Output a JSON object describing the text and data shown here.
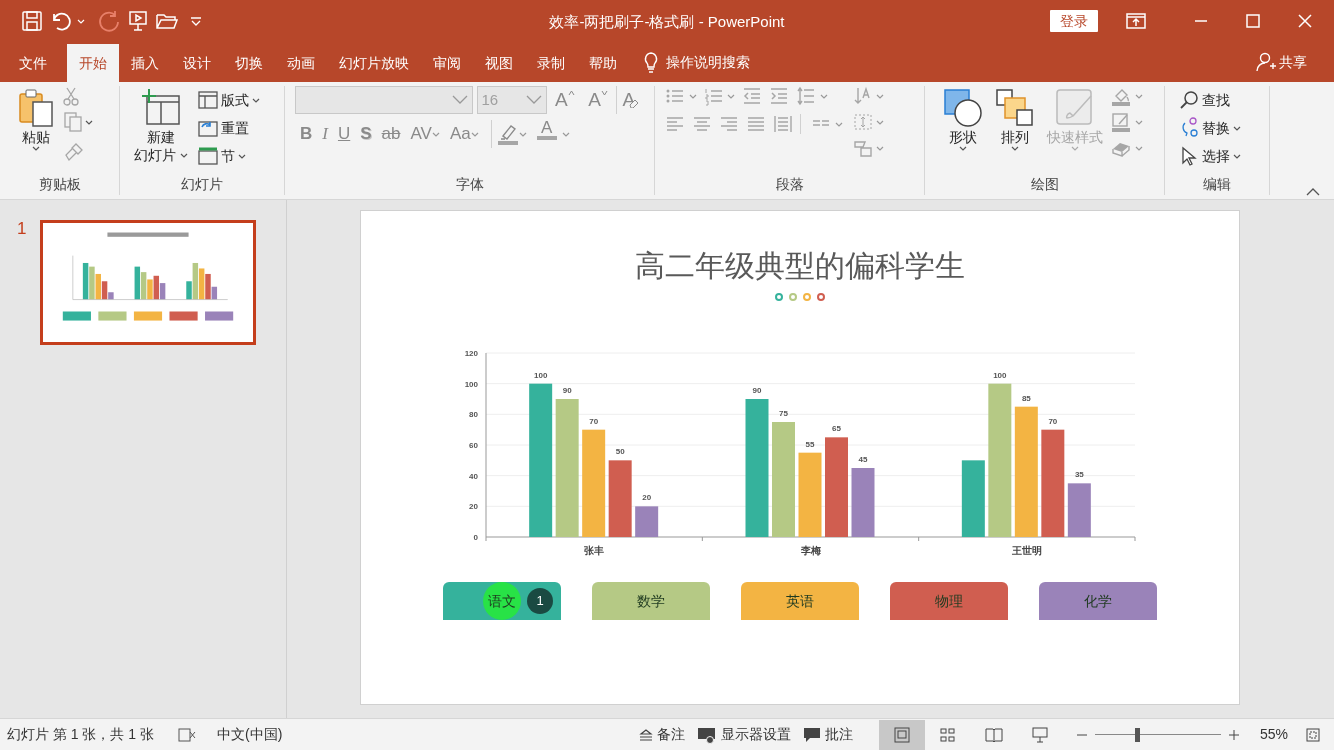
{
  "window": {
    "title": "效率-两把刷子-格式刷  -  PowerPoint",
    "signin": "登录"
  },
  "ribbon_tabs": [
    {
      "label": "文件",
      "selected": false
    },
    {
      "label": "开始",
      "selected": true
    },
    {
      "label": "插入",
      "selected": false
    },
    {
      "label": "设计",
      "selected": false
    },
    {
      "label": "切换",
      "selected": false
    },
    {
      "label": "动画",
      "selected": false
    },
    {
      "label": "幻灯片放映",
      "selected": false
    },
    {
      "label": "审阅",
      "selected": false
    },
    {
      "label": "视图",
      "selected": false
    },
    {
      "label": "录制",
      "selected": false
    },
    {
      "label": "帮助",
      "selected": false
    }
  ],
  "tell_me": "操作说明搜索",
  "share": "共享",
  "ribbon": {
    "clipboard": {
      "paste": "粘贴",
      "label": "剪贴板"
    },
    "slides": {
      "new_slide": [
        "新建",
        "幻灯片"
      ],
      "layout": "版式",
      "reset": "重置",
      "section": "节",
      "label": "幻灯片"
    },
    "font": {
      "size": "16",
      "label": "字体",
      "grow": "A",
      "shrink": "A",
      "clear": "A",
      "buttons": [
        {
          "label": "B",
          "kind": "bold"
        },
        {
          "label": "I",
          "kind": "italic"
        },
        {
          "label": "U",
          "kind": "underline"
        },
        {
          "label": "S",
          "kind": "shadow"
        },
        {
          "label": "ab",
          "kind": "strike"
        },
        {
          "label": "AV",
          "kind": "spacing"
        },
        {
          "label": "Aa",
          "kind": "case"
        },
        {
          "kind": "highlight"
        },
        {
          "label": "A",
          "kind": "color"
        }
      ]
    },
    "paragraph": {
      "label": "段落"
    },
    "drawing": {
      "shapes": "形状",
      "arrange": "排列",
      "quick_styles": "快速样式",
      "label": "绘图"
    },
    "editing": {
      "find": "查找",
      "replace": "替换",
      "select": "选择",
      "label": "编辑"
    }
  },
  "slides_panel": [
    {
      "number": "1",
      "selected": true
    }
  ],
  "slide": {
    "title": "高二年级典型的偏科学生",
    "dots": [
      {
        "color": "#35b29c"
      },
      {
        "color": "#b5c985"
      },
      {
        "color": "#f3b443"
      },
      {
        "color": "#d05e50"
      }
    ],
    "chart_data": {
      "type": "bar",
      "categories": [
        "张丰",
        "李梅",
        "王世明"
      ],
      "ylim": [
        0,
        120
      ],
      "yticks": [
        0,
        20,
        40,
        60,
        80,
        100,
        120
      ],
      "data_labels": true,
      "grid": true,
      "series": [
        {
          "name": "语文",
          "color": "#35b29c",
          "values": [
            100,
            90,
            50
          ],
          "value_labels": [
            "100",
            "90",
            null
          ]
        },
        {
          "name": "数学",
          "color": "#b5c985",
          "values": [
            90,
            75,
            100
          ],
          "value_labels": [
            "90",
            "75",
            "100"
          ]
        },
        {
          "name": "英语",
          "color": "#f3b443",
          "values": [
            70,
            55,
            85
          ],
          "value_labels": [
            "70",
            "55",
            "85"
          ]
        },
        {
          "name": "物理",
          "color": "#d05e50",
          "values": [
            50,
            65,
            70
          ],
          "value_labels": [
            "50",
            "65",
            "70"
          ]
        },
        {
          "name": "化学",
          "color": "#9a83b9",
          "values": [
            20,
            45,
            35
          ],
          "value_labels": [
            "20",
            "45",
            "35"
          ]
        }
      ]
    },
    "click_marker": {
      "count": "1"
    }
  },
  "status_bar": {
    "slide_info": "幻灯片 第 1 张，共 1 张",
    "language": "中文(中国)",
    "notes": "备注",
    "display": "显示器设置",
    "comments": "批注",
    "views": [
      {
        "kind": "normal",
        "selected": true
      },
      {
        "kind": "sorter",
        "selected": false
      },
      {
        "kind": "reading",
        "selected": false
      },
      {
        "kind": "slideshow",
        "selected": false
      }
    ],
    "zoom": {
      "level": 0.33,
      "reading": "55%"
    }
  }
}
